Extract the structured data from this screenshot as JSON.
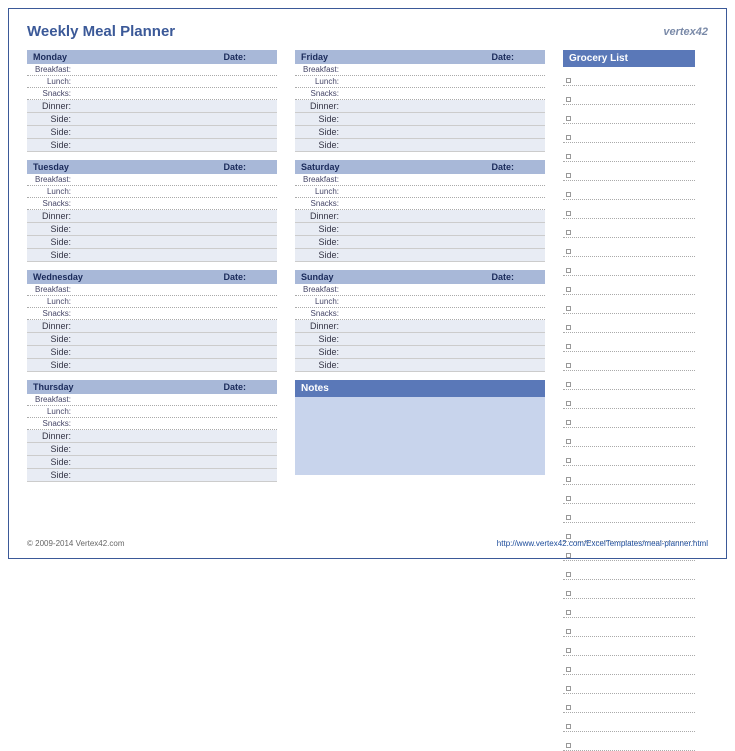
{
  "title": "Weekly Meal Planner",
  "brand": "vertex42",
  "date_label": "Date:",
  "meals": {
    "breakfast": "Breakfast:",
    "lunch": "Lunch:",
    "snacks": "Snacks:",
    "dinner": "Dinner:",
    "side": "Side:"
  },
  "days": [
    "Monday",
    "Tuesday",
    "Wednesday",
    "Thursday",
    "Friday",
    "Saturday",
    "Sunday"
  ],
  "notes_title": "Notes",
  "grocery_title": "Grocery List",
  "grocery_count": 36,
  "footer": {
    "copyright": "© 2009-2014 Vertex42.com",
    "link": "http://www.vertex42.com/ExcelTemplates/meal-planner.html"
  }
}
